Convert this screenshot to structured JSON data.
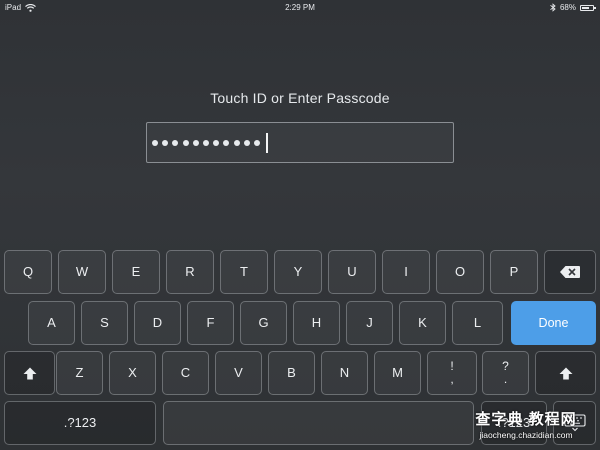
{
  "status_bar": {
    "device": "iPad",
    "time": "2:29 PM",
    "battery_percent": "68%",
    "battery_level": 0.68,
    "icons": [
      "wifi-icon",
      "bluetooth-icon",
      "battery-icon"
    ]
  },
  "lock": {
    "prompt": "Touch ID or Enter Passcode",
    "entered_digit_count": 11
  },
  "keyboard": {
    "row1": [
      "Q",
      "W",
      "E",
      "R",
      "T",
      "Y",
      "U",
      "I",
      "O",
      "P"
    ],
    "row2": [
      "A",
      "S",
      "D",
      "F",
      "G",
      "H",
      "J",
      "K",
      "L"
    ],
    "row3": [
      "Z",
      "X",
      "C",
      "V",
      "B",
      "N",
      "M"
    ],
    "punct1": {
      "top": "!",
      "bottom": ","
    },
    "punct2": {
      "top": "?",
      "bottom": "."
    },
    "done_label": "Done",
    "numbers_left_label": ".?123",
    "numbers_right_label": ".?123",
    "done_color": "#4d9ee8",
    "icons": [
      "backspace-icon",
      "shift-icon",
      "keyboard-dismiss-icon"
    ]
  },
  "watermark": {
    "main": "查字典 教程网",
    "sub": "jiaocheng.chazidian.com"
  }
}
